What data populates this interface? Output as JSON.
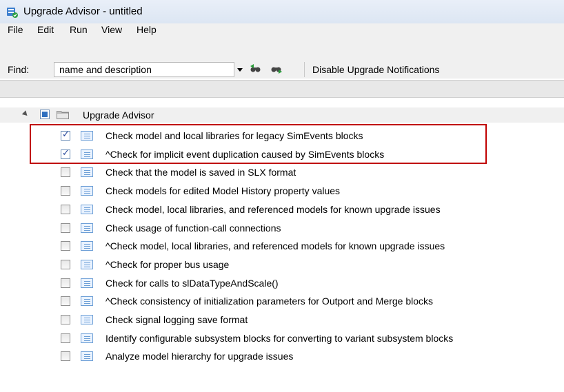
{
  "window": {
    "title": "Upgrade Advisor - untitled"
  },
  "menu": [
    "File",
    "Edit",
    "Run",
    "View",
    "Help"
  ],
  "toolbar": {
    "find_label": "Find:",
    "find_value": "name and description",
    "disable_label": "Disable Upgrade Notifications"
  },
  "tree": {
    "root_label": "Upgrade Advisor",
    "items": [
      {
        "label": "Check model and local libraries for legacy SimEvents blocks",
        "checked": true
      },
      {
        "label": "^Check for implicit event duplication caused by SimEvents blocks",
        "checked": true
      },
      {
        "label": "Check that the model is saved in SLX format",
        "checked": false
      },
      {
        "label": "Check models for edited Model History property values",
        "checked": false
      },
      {
        "label": "Check model, local libraries, and referenced models for known upgrade issues",
        "checked": false
      },
      {
        "label": "Check usage of function-call connections",
        "checked": false
      },
      {
        "label": "^Check model, local libraries, and referenced models for known upgrade issues",
        "checked": false
      },
      {
        "label": "^Check for proper bus usage",
        "checked": false
      },
      {
        "label": "Check for calls to slDataTypeAndScale()",
        "checked": false
      },
      {
        "label": "^Check consistency of initialization parameters for Outport and Merge blocks",
        "checked": false
      },
      {
        "label": "Check signal logging save format",
        "checked": false
      },
      {
        "label": "Identify configurable subsystem blocks for converting to variant subsystem blocks",
        "checked": false
      },
      {
        "label": "Analyze model hierarchy for upgrade issues",
        "checked": false
      }
    ]
  },
  "colors": {
    "highlight": "#c00000",
    "checkmark": "#24459b"
  }
}
